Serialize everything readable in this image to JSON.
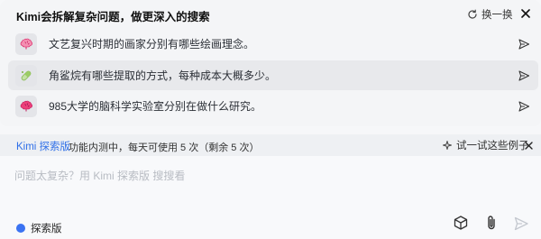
{
  "suggestions_panel": {
    "title": "Kimi会拆解复杂问题，做更深入的搜索",
    "refresh_label": "换一换",
    "items": [
      {
        "text": "文艺复兴时期的画家分别有哪些绘画理念。",
        "icon": "brain-icon",
        "active": false
      },
      {
        "text": "角鲨烷有哪些提取的方式，每种成本大概多少。",
        "icon": "pill-icon",
        "active": true
      },
      {
        "text": "985大学的脑科学实验室分别在做什么研究。",
        "icon": "brain-icon",
        "active": false
      }
    ]
  },
  "mode_bar": {
    "name": "Kimi 探索版",
    "description": "功能内测中，每天可使用 5 次（剩余 5 次）",
    "try_label": "试一试这些例子"
  },
  "composer": {
    "placeholder": "问题太复杂？用 Kimi 探索版 搜搜看",
    "value": "",
    "toggle_label": "探索版"
  },
  "colors": {
    "accent": "#3b73f2",
    "mode_name": "#2f6fe8",
    "brain_pink": "#f06292"
  }
}
